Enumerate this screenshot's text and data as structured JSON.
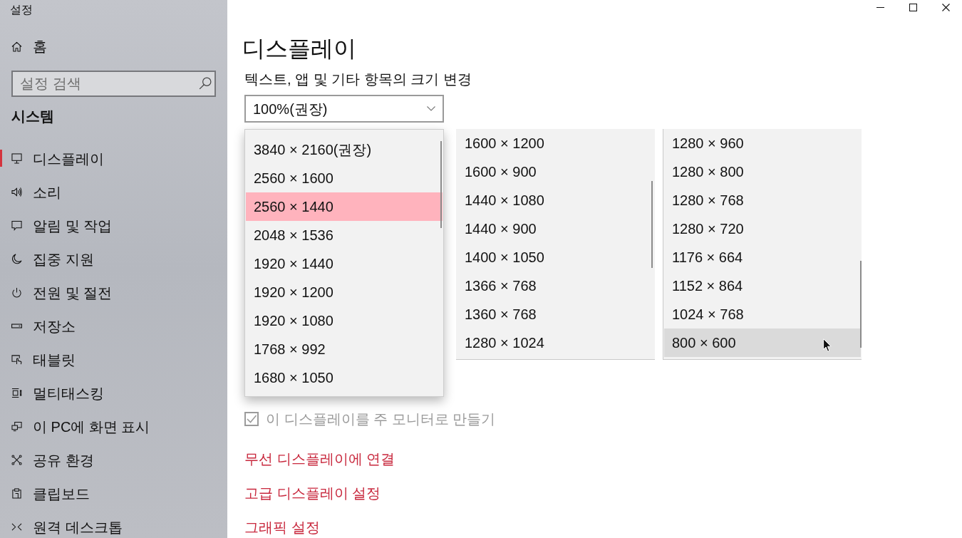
{
  "window": {
    "title": "설정"
  },
  "sidebar": {
    "home": {
      "label": "홈"
    },
    "search": {
      "placeholder": "설정 검색"
    },
    "section_title": "시스템",
    "items": [
      {
        "label": "디스플레이",
        "selected": true
      },
      {
        "label": "소리",
        "selected": false
      },
      {
        "label": "알림 및 작업",
        "selected": false
      },
      {
        "label": "집중 지원",
        "selected": false
      },
      {
        "label": "전원 및 절전",
        "selected": false
      },
      {
        "label": "저장소",
        "selected": false
      },
      {
        "label": "태블릿",
        "selected": false
      },
      {
        "label": "멀티태스킹",
        "selected": false
      },
      {
        "label": "이 PC에 화면 표시",
        "selected": false
      },
      {
        "label": "공유 환경",
        "selected": false
      },
      {
        "label": "클립보드",
        "selected": false
      },
      {
        "label": "원격 데스크톱",
        "selected": false
      }
    ]
  },
  "main": {
    "title": "디스플레이",
    "scale_label": "텍스트, 앱 및 기타 항목의 크기 변경",
    "scale_dropdown": {
      "value": "100%(권장)"
    },
    "resolution_lists": [
      {
        "kind": "popup",
        "items": [
          {
            "label": "3840 × 2160(권장)",
            "selected": false,
            "hovered": false
          },
          {
            "label": "2560 × 1600",
            "selected": false,
            "hovered": false
          },
          {
            "label": "2560 × 1440",
            "selected": true,
            "hovered": false
          },
          {
            "label": "2048 × 1536",
            "selected": false,
            "hovered": false
          },
          {
            "label": "1920 × 1440",
            "selected": false,
            "hovered": false
          },
          {
            "label": "1920 × 1200",
            "selected": false,
            "hovered": false
          },
          {
            "label": "1920 × 1080",
            "selected": false,
            "hovered": false
          },
          {
            "label": "1768 × 992",
            "selected": false,
            "hovered": false
          },
          {
            "label": "1680 × 1050",
            "selected": false,
            "hovered": false
          }
        ]
      },
      {
        "kind": "panel",
        "items": [
          {
            "label": "1600 × 1200",
            "selected": false,
            "hovered": false
          },
          {
            "label": "1600 × 900",
            "selected": false,
            "hovered": false
          },
          {
            "label": "1440 × 1080",
            "selected": false,
            "hovered": false
          },
          {
            "label": "1440 × 900",
            "selected": false,
            "hovered": false
          },
          {
            "label": "1400 × 1050",
            "selected": false,
            "hovered": false
          },
          {
            "label": "1366 × 768",
            "selected": false,
            "hovered": false
          },
          {
            "label": "1360 × 768",
            "selected": false,
            "hovered": false
          },
          {
            "label": "1280 × 1024",
            "selected": false,
            "hovered": false
          }
        ]
      },
      {
        "kind": "panel",
        "items": [
          {
            "label": "1280 × 960",
            "selected": false,
            "hovered": false
          },
          {
            "label": "1280 × 800",
            "selected": false,
            "hovered": false
          },
          {
            "label": "1280 × 768",
            "selected": false,
            "hovered": false
          },
          {
            "label": "1280 × 720",
            "selected": false,
            "hovered": false
          },
          {
            "label": "1176 × 664",
            "selected": false,
            "hovered": false
          },
          {
            "label": "1152 × 864",
            "selected": false,
            "hovered": false
          },
          {
            "label": "1024 × 768",
            "selected": false,
            "hovered": false
          },
          {
            "label": "800 × 600",
            "selected": false,
            "hovered": true
          }
        ]
      }
    ],
    "primary_monitor": {
      "label": "이 디스플레이를 주 모니터로 만들기",
      "checked": true,
      "disabled": true
    },
    "links": [
      {
        "label": "무선 디스플레이에 연결"
      },
      {
        "label": "고급 디스플레이 설정"
      },
      {
        "label": "그래픽 설정"
      }
    ]
  }
}
